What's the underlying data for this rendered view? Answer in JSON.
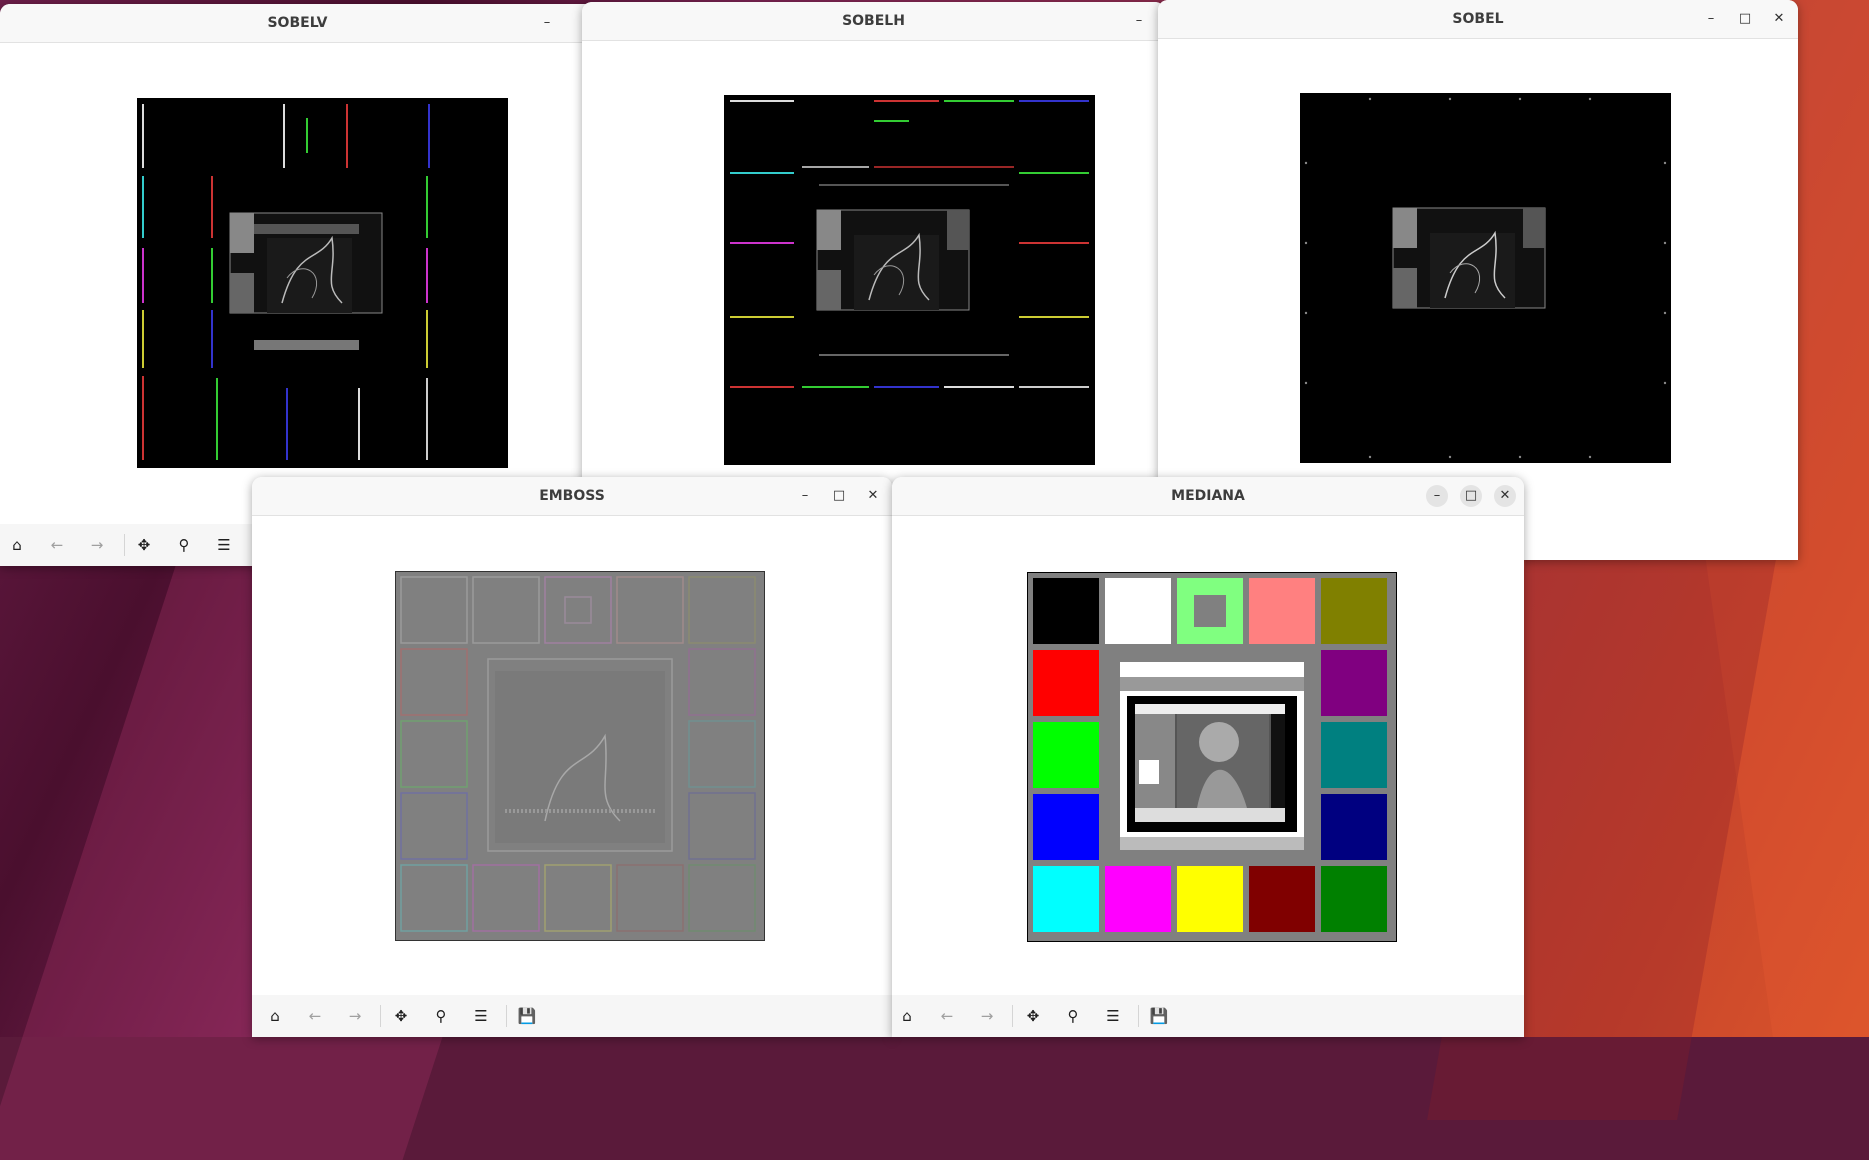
{
  "windows": {
    "sobelv": {
      "title": "SOBELV"
    },
    "sobelh": {
      "title": "SOBELH"
    },
    "sobel": {
      "title": "SOBEL"
    },
    "emboss": {
      "title": "EMBOSS"
    },
    "mediana": {
      "title": "MEDIANA"
    }
  },
  "window_controls": {
    "minimize": "–",
    "maximize": "□",
    "close": "✕"
  },
  "toolbar_icons": [
    "home-icon",
    "back-arrow-icon",
    "forward-arrow-icon",
    "pan-move-icon",
    "zoom-icon",
    "configure-subplots-icon",
    "save-icon"
  ],
  "toolbar_state": {
    "back_enabled": false,
    "forward_enabled": false
  },
  "mediana_palette": [
    "#000000",
    "#ffffff",
    "#80ff80",
    "#ff8080",
    "#808000",
    "#ff0000",
    "#800080",
    "#00ff00",
    "#008080",
    "#0000ff",
    "#000080",
    "#00ffff",
    "#ff00ff",
    "#ffff00",
    "#800000",
    "#008000"
  ],
  "colors": {
    "titlebar": "#f8f8f8",
    "toolbar": "#f6f6f6",
    "emboss_gray": "#808080"
  }
}
